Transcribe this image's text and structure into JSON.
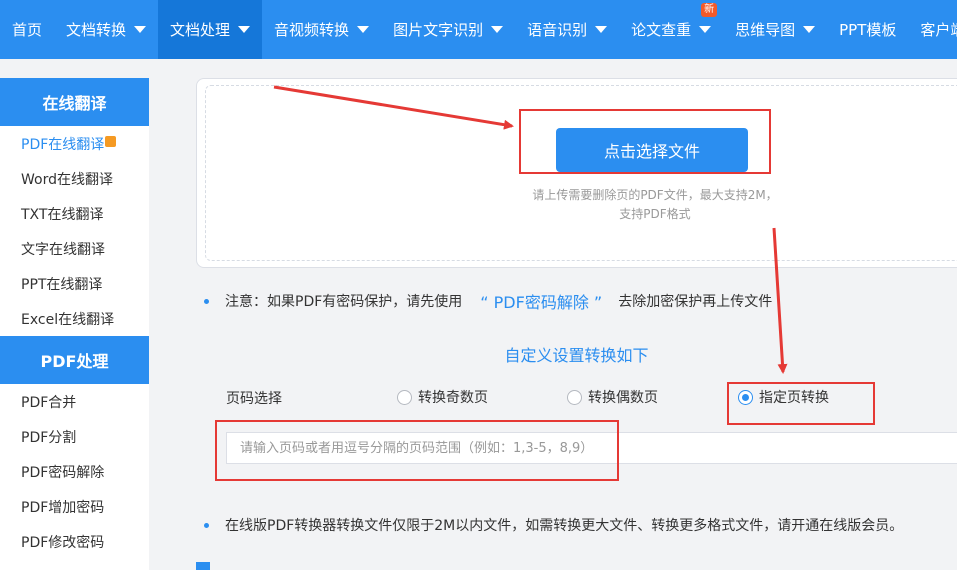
{
  "nav": {
    "items": [
      {
        "label": "首页",
        "caret": false,
        "active": false
      },
      {
        "label": "文档转换",
        "caret": true,
        "active": false
      },
      {
        "label": "文档处理",
        "caret": true,
        "active": true
      },
      {
        "label": "音视频转换",
        "caret": true,
        "active": false
      },
      {
        "label": "图片文字识别",
        "caret": true,
        "active": false
      },
      {
        "label": "语音识别",
        "caret": true,
        "active": false
      },
      {
        "label": "论文查重",
        "caret": true,
        "active": false,
        "badge": "新"
      },
      {
        "label": "思维导图",
        "caret": true,
        "active": false
      },
      {
        "label": "PPT模板",
        "caret": false,
        "active": false
      },
      {
        "label": "客户端",
        "caret": false,
        "active": false
      }
    ]
  },
  "sidebar": {
    "translate_heading": "在线翻译",
    "translate_items": [
      "PDF在线翻译",
      "Word在线翻译",
      "TXT在线翻译",
      "文字在线翻译",
      "PPT在线翻译",
      "Excel在线翻译"
    ],
    "pdf_heading": "PDF处理",
    "pdf_items": [
      "PDF合并",
      "PDF分割",
      "PDF密码解除",
      "PDF增加密码",
      "PDF修改密码"
    ]
  },
  "upload": {
    "button_label": "点击选择文件",
    "tip_line1": "请上传需要删除页的PDF文件，最大支持2M，",
    "tip_line2": "支持PDF格式"
  },
  "note": {
    "prefix": "注意：如果PDF有密码保护，请先使用",
    "link": "“ PDF密码解除 ”",
    "suffix": "去除加密保护再上传文件"
  },
  "settings": {
    "title": "自定义设置转换如下",
    "page_label": "页码选择",
    "options": [
      "转换奇数页",
      "转换偶数页",
      "指定页转换"
    ],
    "selected": "指定页转换",
    "input_placeholder": "请输入页码或者用逗号分隔的页码范围（例如：1,3-5，8,9）"
  },
  "info": {
    "text": "在线版PDF转换器转换文件仅限于2M以内文件，如需转换更大文件、转换更多格式文件，请开通在线版会员。"
  },
  "colors": {
    "primary": "#2b8ef0",
    "highlight": "#e53935",
    "badge": "#f25a2a"
  }
}
